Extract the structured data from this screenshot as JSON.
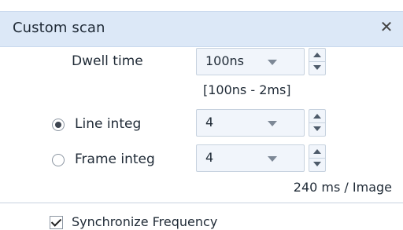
{
  "panel": {
    "title": "Custom scan",
    "close_icon": "close-icon"
  },
  "dwell": {
    "label": "Dwell time",
    "value": "100ns",
    "range": "[100ns - 2ms]"
  },
  "line_integ": {
    "label": "Line integ",
    "value": "4",
    "selected": true
  },
  "frame_integ": {
    "label": "Frame integ",
    "value": "4",
    "selected": false
  },
  "frame_rate": "240 ms / Image",
  "sync": {
    "label": "Synchronize Frequency",
    "checked": true
  }
}
